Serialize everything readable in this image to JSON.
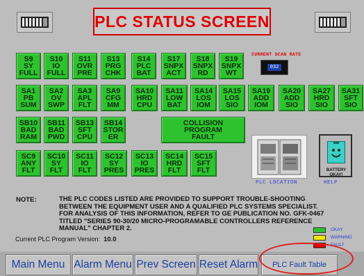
{
  "title": "PLC STATUS SCREEN",
  "scan_rate": {
    "label": "CURRENT SCAN RATE",
    "value": "032"
  },
  "tiles": [
    {
      "code": "S9",
      "l2": "SY",
      "l3": "FULL"
    },
    {
      "code": "S10",
      "l2": "IO",
      "l3": "FULL"
    },
    {
      "code": "S11",
      "l2": "OVR",
      "l3": "PRE"
    },
    {
      "code": "S13",
      "l2": "PRG",
      "l3": "CHK"
    },
    {
      "code": "S14",
      "l2": "PLC",
      "l3": "BAT"
    },
    {
      "code": "S17",
      "l2": "SNPX",
      "l3": "ACT"
    },
    {
      "code": "S18",
      "l2": "SNPX",
      "l3": "RD"
    },
    {
      "code": "S19",
      "l2": "SNPX",
      "l3": "WT"
    },
    {
      "code": "SA1",
      "l2": "PB",
      "l3": "SUM"
    },
    {
      "code": "SA2",
      "l2": "OV",
      "l3": "SWP"
    },
    {
      "code": "SA3",
      "l2": "APL",
      "l3": "FLT"
    },
    {
      "code": "SA9",
      "l2": "CFG",
      "l3": "MM"
    },
    {
      "code": "SA10",
      "l2": "HRD",
      "l3": "CPU"
    },
    {
      "code": "SA11",
      "l2": "LOW",
      "l3": "BAT"
    },
    {
      "code": "SA14",
      "l2": "LOS",
      "l3": "IOM"
    },
    {
      "code": "SA15",
      "l2": "LOS",
      "l3": "SIO"
    },
    {
      "code": "SA19",
      "l2": "ADD",
      "l3": "IOM"
    },
    {
      "code": "SA20",
      "l2": "ADD",
      "l3": "SIO"
    },
    {
      "code": "SA27",
      "l2": "HRD",
      "l3": "SIO"
    },
    {
      "code": "SA31",
      "l2": "SFT",
      "l3": "SIO"
    },
    {
      "code": "SB10",
      "l2": "BAD",
      "l3": "RAM"
    },
    {
      "code": "SB11",
      "l2": "BAD",
      "l3": "PWD"
    },
    {
      "code": "SB13",
      "l2": "SFT",
      "l3": "CPU"
    },
    {
      "code": "SB14",
      "l2": "STOR",
      "l3": "ER"
    },
    {
      "code": "COLLISION",
      "l2": "PROGRAM",
      "l3": "FAULT"
    },
    {
      "code": "SC9",
      "l2": "ANY",
      "l3": "FLT"
    },
    {
      "code": "SC10",
      "l2": "SY",
      "l3": "FLT"
    },
    {
      "code": "SC11",
      "l2": "IO",
      "l3": "FLT"
    },
    {
      "code": "SC12",
      "l2": "SY",
      "l3": "PRES"
    },
    {
      "code": "SC13",
      "l2": "IO",
      "l3": "PRES"
    },
    {
      "code": "SC14",
      "l2": "HRD",
      "l3": "FLT"
    },
    {
      "code": "SC15",
      "l2": "SFT",
      "l3": "FLT"
    }
  ],
  "plc_location_label": "PLC LOCATION",
  "help_label": "HELP",
  "battery_label": "BATTERY OKAY!",
  "note_label": "NOTE:",
  "note_lines": [
    "THE PLC CODES LISTED ARE PROVIDED TO SUPPORT TROUBLE-SHOOTING",
    "BETWEEN THE EQUIPMENT USER AND A QUALIFIED PLC SYSTEMS SPECIALIST.",
    "FOR ANALYSIS OF THIS INFORMATION, REFER TO GE PUBLICATION NO. GFK-0467",
    "TITLED \"SERIES 90-30/20 MICRO-PROGRAMABLE CONTROLLERS REFERENCE",
    "MANUAL\" CHAPTER 2."
  ],
  "version": {
    "label": "Current PLC Program Version:",
    "value": "10.0"
  },
  "legend": [
    {
      "label": "OKAY",
      "color": "#2fc22f"
    },
    {
      "label": "WARNING",
      "color": "#f2e600"
    },
    {
      "label": "FAULT",
      "color": "#e00000"
    }
  ],
  "nav": {
    "main_menu": "Main Menu",
    "alarm_menu": "Alarm Menu",
    "prev_screen": "Prev Screen",
    "reset_alarm": "Reset Alarm",
    "plc_fault_table": "PLC Fault Table"
  }
}
